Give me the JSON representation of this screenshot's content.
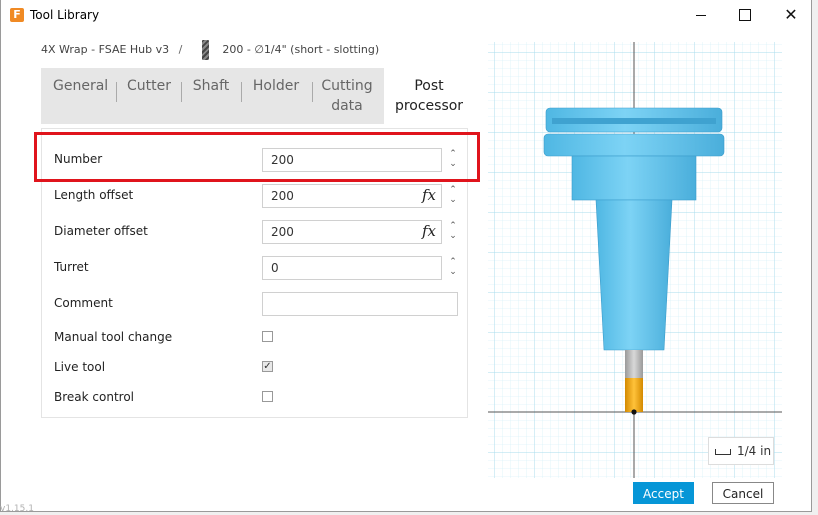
{
  "window": {
    "title": "Tool Library",
    "logo_letter": "F",
    "minimize_label": "",
    "maximize_label": "",
    "close_label": "✕"
  },
  "breadcrumb": {
    "library": "4X Wrap - FSAE Hub v3",
    "separator": "/",
    "tool": "200 - ∅1/4\" (short - slotting)"
  },
  "tabs": [
    {
      "label": "General",
      "active": false
    },
    {
      "label": "Cutter",
      "active": false
    },
    {
      "label": "Shaft",
      "active": false
    },
    {
      "label": "Holder",
      "active": false
    },
    {
      "label": "Cutting\ndata",
      "active": false
    },
    {
      "label": "Post\nprocessor",
      "active": true
    }
  ],
  "form": {
    "number": {
      "label": "Number",
      "value": "200"
    },
    "length_offset": {
      "label": "Length offset",
      "value": "200",
      "fx": "fx"
    },
    "diameter_offset": {
      "label": "Diameter offset",
      "value": "200",
      "fx": "fx"
    },
    "turret": {
      "label": "Turret",
      "value": "0"
    },
    "comment": {
      "label": "Comment",
      "value": ""
    },
    "manual_tool_change": {
      "label": "Manual tool change",
      "checked": false
    },
    "live_tool": {
      "label": "Live tool",
      "checked": true,
      "mark": "✓"
    },
    "break_control": {
      "label": "Break control",
      "checked": false
    }
  },
  "spinner": {
    "up": "⌃",
    "down": "⌄"
  },
  "preview": {
    "scale_label": "1/4 in",
    "holder_color": "#66c8ee",
    "tool_color": "#f0a818",
    "shank_color": "#b9b9b9",
    "grid_color": "#bfe6f2"
  },
  "buttons": {
    "accept": "Accept",
    "cancel": "Cancel"
  },
  "version": "v1.15.1",
  "colors": {
    "accent": "#0696d7",
    "highlight": "#e0141c"
  }
}
